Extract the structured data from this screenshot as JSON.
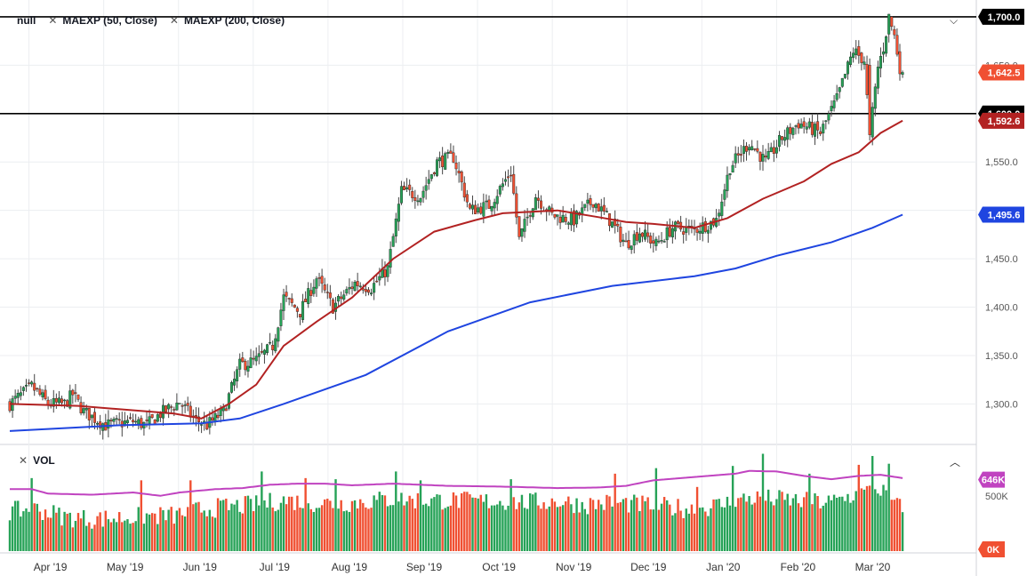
{
  "legend": {
    "symbol": "null",
    "indicators": [
      {
        "label": "MAEXP (50, Close)",
        "color": "#b22222"
      },
      {
        "label": "MAEXP (200, Close)",
        "color": "#1f45e0"
      }
    ],
    "volume_label": "VOL"
  },
  "colors": {
    "up": "#26a257",
    "down": "#f05032",
    "ma50": "#b22222",
    "ma200": "#1f45e0",
    "vol_ma": "#c043c0",
    "hline": "#000000",
    "price_badge": "#f05032",
    "vol_badge": "#c043c0"
  },
  "chart_data": [
    {
      "type": "candlestick",
      "x_ticks": [
        "Apr '19",
        "May '19",
        "Jun '19",
        "Jul '19",
        "Aug '19",
        "Sep '19",
        "Oct '19",
        "Nov '19",
        "Dec '19",
        "Jan '20",
        "Feb '20",
        "Mar '20"
      ],
      "y_ticks": [
        "1,300.0",
        "1,350.0",
        "1,400.0",
        "1,450.0",
        "1,500.0",
        "1,550.0",
        "1,600.0",
        "1,650.0",
        "1,700.0"
      ],
      "ylim": [
        1260,
        1710
      ],
      "horizontal_lines": [
        1700,
        1600
      ],
      "price_anchors": [
        [
          0,
          1300
        ],
        [
          8,
          1318
        ],
        [
          14,
          1300
        ],
        [
          20,
          1300
        ],
        [
          23,
          1310
        ],
        [
          27,
          1292
        ],
        [
          35,
          1278
        ],
        [
          45,
          1282
        ],
        [
          50,
          1278
        ],
        [
          55,
          1290
        ],
        [
          62,
          1302
        ],
        [
          67,
          1285
        ],
        [
          72,
          1278
        ],
        [
          78,
          1292
        ],
        [
          84,
          1340
        ],
        [
          90,
          1345
        ],
        [
          96,
          1360
        ],
        [
          100,
          1410
        ],
        [
          106,
          1395
        ],
        [
          112,
          1430
        ],
        [
          118,
          1400
        ],
        [
          126,
          1425
        ],
        [
          132,
          1420
        ],
        [
          138,
          1440
        ],
        [
          143,
          1520
        ],
        [
          150,
          1515
        ],
        [
          156,
          1550
        ],
        [
          162,
          1555
        ],
        [
          168,
          1500
        ],
        [
          175,
          1505
        ],
        [
          183,
          1540
        ],
        [
          186,
          1470
        ],
        [
          192,
          1515
        ],
        [
          198,
          1495
        ],
        [
          206,
          1490
        ],
        [
          213,
          1510
        ],
        [
          219,
          1490
        ],
        [
          225,
          1465
        ],
        [
          230,
          1478
        ],
        [
          236,
          1465
        ],
        [
          242,
          1482
        ],
        [
          250,
          1480
        ],
        [
          258,
          1490
        ],
        [
          263,
          1545
        ],
        [
          270,
          1570
        ],
        [
          276,
          1550
        ],
        [
          282,
          1575
        ],
        [
          288,
          1590
        ],
        [
          296,
          1580
        ],
        [
          302,
          1615
        ],
        [
          308,
          1665
        ],
        [
          312,
          1655
        ],
        [
          314,
          1578
        ],
        [
          317,
          1648
        ],
        [
          319,
          1668
        ],
        [
          321,
          1700
        ],
        [
          323,
          1680
        ],
        [
          325,
          1648
        ],
        [
          326,
          1642
        ]
      ],
      "ma_series": [
        {
          "name": "MAEXP (50, Close)",
          "last": "1,592.6",
          "color_key": "ma50",
          "points": [
            [
              0,
              1300
            ],
            [
              25,
              1298
            ],
            [
              60,
              1290
            ],
            [
              70,
              1285
            ],
            [
              80,
              1300
            ],
            [
              90,
              1320
            ],
            [
              100,
              1360
            ],
            [
              112,
              1385
            ],
            [
              125,
              1410
            ],
            [
              140,
              1450
            ],
            [
              155,
              1478
            ],
            [
              170,
              1490
            ],
            [
              180,
              1497
            ],
            [
              200,
              1500
            ],
            [
              215,
              1493
            ],
            [
              225,
              1488
            ],
            [
              235,
              1486
            ],
            [
              250,
              1482
            ],
            [
              262,
              1492
            ],
            [
              275,
              1512
            ],
            [
              290,
              1530
            ],
            [
              300,
              1548
            ],
            [
              310,
              1560
            ],
            [
              318,
              1580
            ],
            [
              326,
              1592.6
            ]
          ]
        },
        {
          "name": "MAEXP (200, Close)",
          "last": "1,495.6",
          "color_key": "ma200",
          "points": [
            [
              0,
              1272
            ],
            [
              40,
              1278
            ],
            [
              70,
              1280
            ],
            [
              84,
              1285
            ],
            [
              100,
              1300
            ],
            [
              130,
              1330
            ],
            [
              160,
              1375
            ],
            [
              190,
              1405
            ],
            [
              220,
              1422
            ],
            [
              250,
              1432
            ],
            [
              265,
              1440
            ],
            [
              280,
              1453
            ],
            [
              300,
              1467
            ],
            [
              315,
              1482
            ],
            [
              326,
              1495.6
            ]
          ]
        }
      ],
      "value_badges": [
        {
          "label": "1,700.0",
          "value": 1700,
          "kind": "hline"
        },
        {
          "label": "1,642.5",
          "value": 1642.5,
          "kind": "last"
        },
        {
          "label": "1,600.0",
          "value": 1600,
          "kind": "hline"
        },
        {
          "label": "1,592.6",
          "value": 1592.6,
          "kind": "ma50"
        },
        {
          "label": "1,495.6",
          "value": 1495.6,
          "kind": "ma200"
        }
      ]
    },
    {
      "type": "bar",
      "title": "VOL",
      "ylim": [
        0,
        900000
      ],
      "y_ticks": [
        {
          "label": "500K",
          "value": 500000
        }
      ],
      "badges": [
        {
          "label": "646K",
          "value": 646000,
          "kind": "vol"
        },
        {
          "label": "0K",
          "value": 0,
          "kind": "zero"
        }
      ],
      "volume_anchors": [
        [
          0,
          360
        ],
        [
          10,
          380
        ],
        [
          20,
          310
        ],
        [
          30,
          290
        ],
        [
          40,
          300
        ],
        [
          50,
          320
        ],
        [
          60,
          320
        ],
        [
          70,
          380
        ],
        [
          80,
          400
        ],
        [
          90,
          420
        ],
        [
          100,
          460
        ],
        [
          110,
          440
        ],
        [
          120,
          430
        ],
        [
          130,
          450
        ],
        [
          140,
          470
        ],
        [
          150,
          460
        ],
        [
          160,
          460
        ],
        [
          170,
          450
        ],
        [
          180,
          450
        ],
        [
          190,
          440
        ],
        [
          200,
          450
        ],
        [
          210,
          420
        ],
        [
          220,
          440
        ],
        [
          230,
          420
        ],
        [
          240,
          400
        ],
        [
          250,
          380
        ],
        [
          260,
          420
        ],
        [
          270,
          480
        ],
        [
          280,
          470
        ],
        [
          290,
          450
        ],
        [
          300,
          440
        ],
        [
          310,
          520
        ],
        [
          318,
          560
        ],
        [
          326,
          370
        ]
      ],
      "volume_spikes": [
        [
          8,
          660
        ],
        [
          48,
          640
        ],
        [
          66,
          640
        ],
        [
          92,
          720
        ],
        [
          108,
          660
        ],
        [
          119,
          650
        ],
        [
          141,
          720
        ],
        [
          150,
          640
        ],
        [
          183,
          650
        ],
        [
          221,
          700
        ],
        [
          236,
          750
        ],
        [
          251,
          580
        ],
        [
          264,
          770
        ],
        [
          275,
          880
        ],
        [
          292,
          700
        ],
        [
          310,
          780
        ],
        [
          315,
          860
        ],
        [
          321,
          790
        ]
      ],
      "vol_ma_anchors": [
        [
          0,
          560
        ],
        [
          8,
          560
        ],
        [
          14,
          520
        ],
        [
          30,
          510
        ],
        [
          45,
          530
        ],
        [
          55,
          500
        ],
        [
          62,
          530
        ],
        [
          75,
          560
        ],
        [
          85,
          570
        ],
        [
          95,
          600
        ],
        [
          105,
          610
        ],
        [
          115,
          610
        ],
        [
          125,
          595
        ],
        [
          140,
          610
        ],
        [
          150,
          600
        ],
        [
          160,
          590
        ],
        [
          175,
          585
        ],
        [
          185,
          580
        ],
        [
          200,
          570
        ],
        [
          215,
          575
        ],
        [
          225,
          590
        ],
        [
          235,
          640
        ],
        [
          245,
          660
        ],
        [
          255,
          680
        ],
        [
          265,
          700
        ],
        [
          270,
          725
        ],
        [
          280,
          720
        ],
        [
          290,
          680
        ],
        [
          300,
          650
        ],
        [
          310,
          680
        ],
        [
          318,
          690
        ],
        [
          326,
          660
        ]
      ]
    }
  ]
}
